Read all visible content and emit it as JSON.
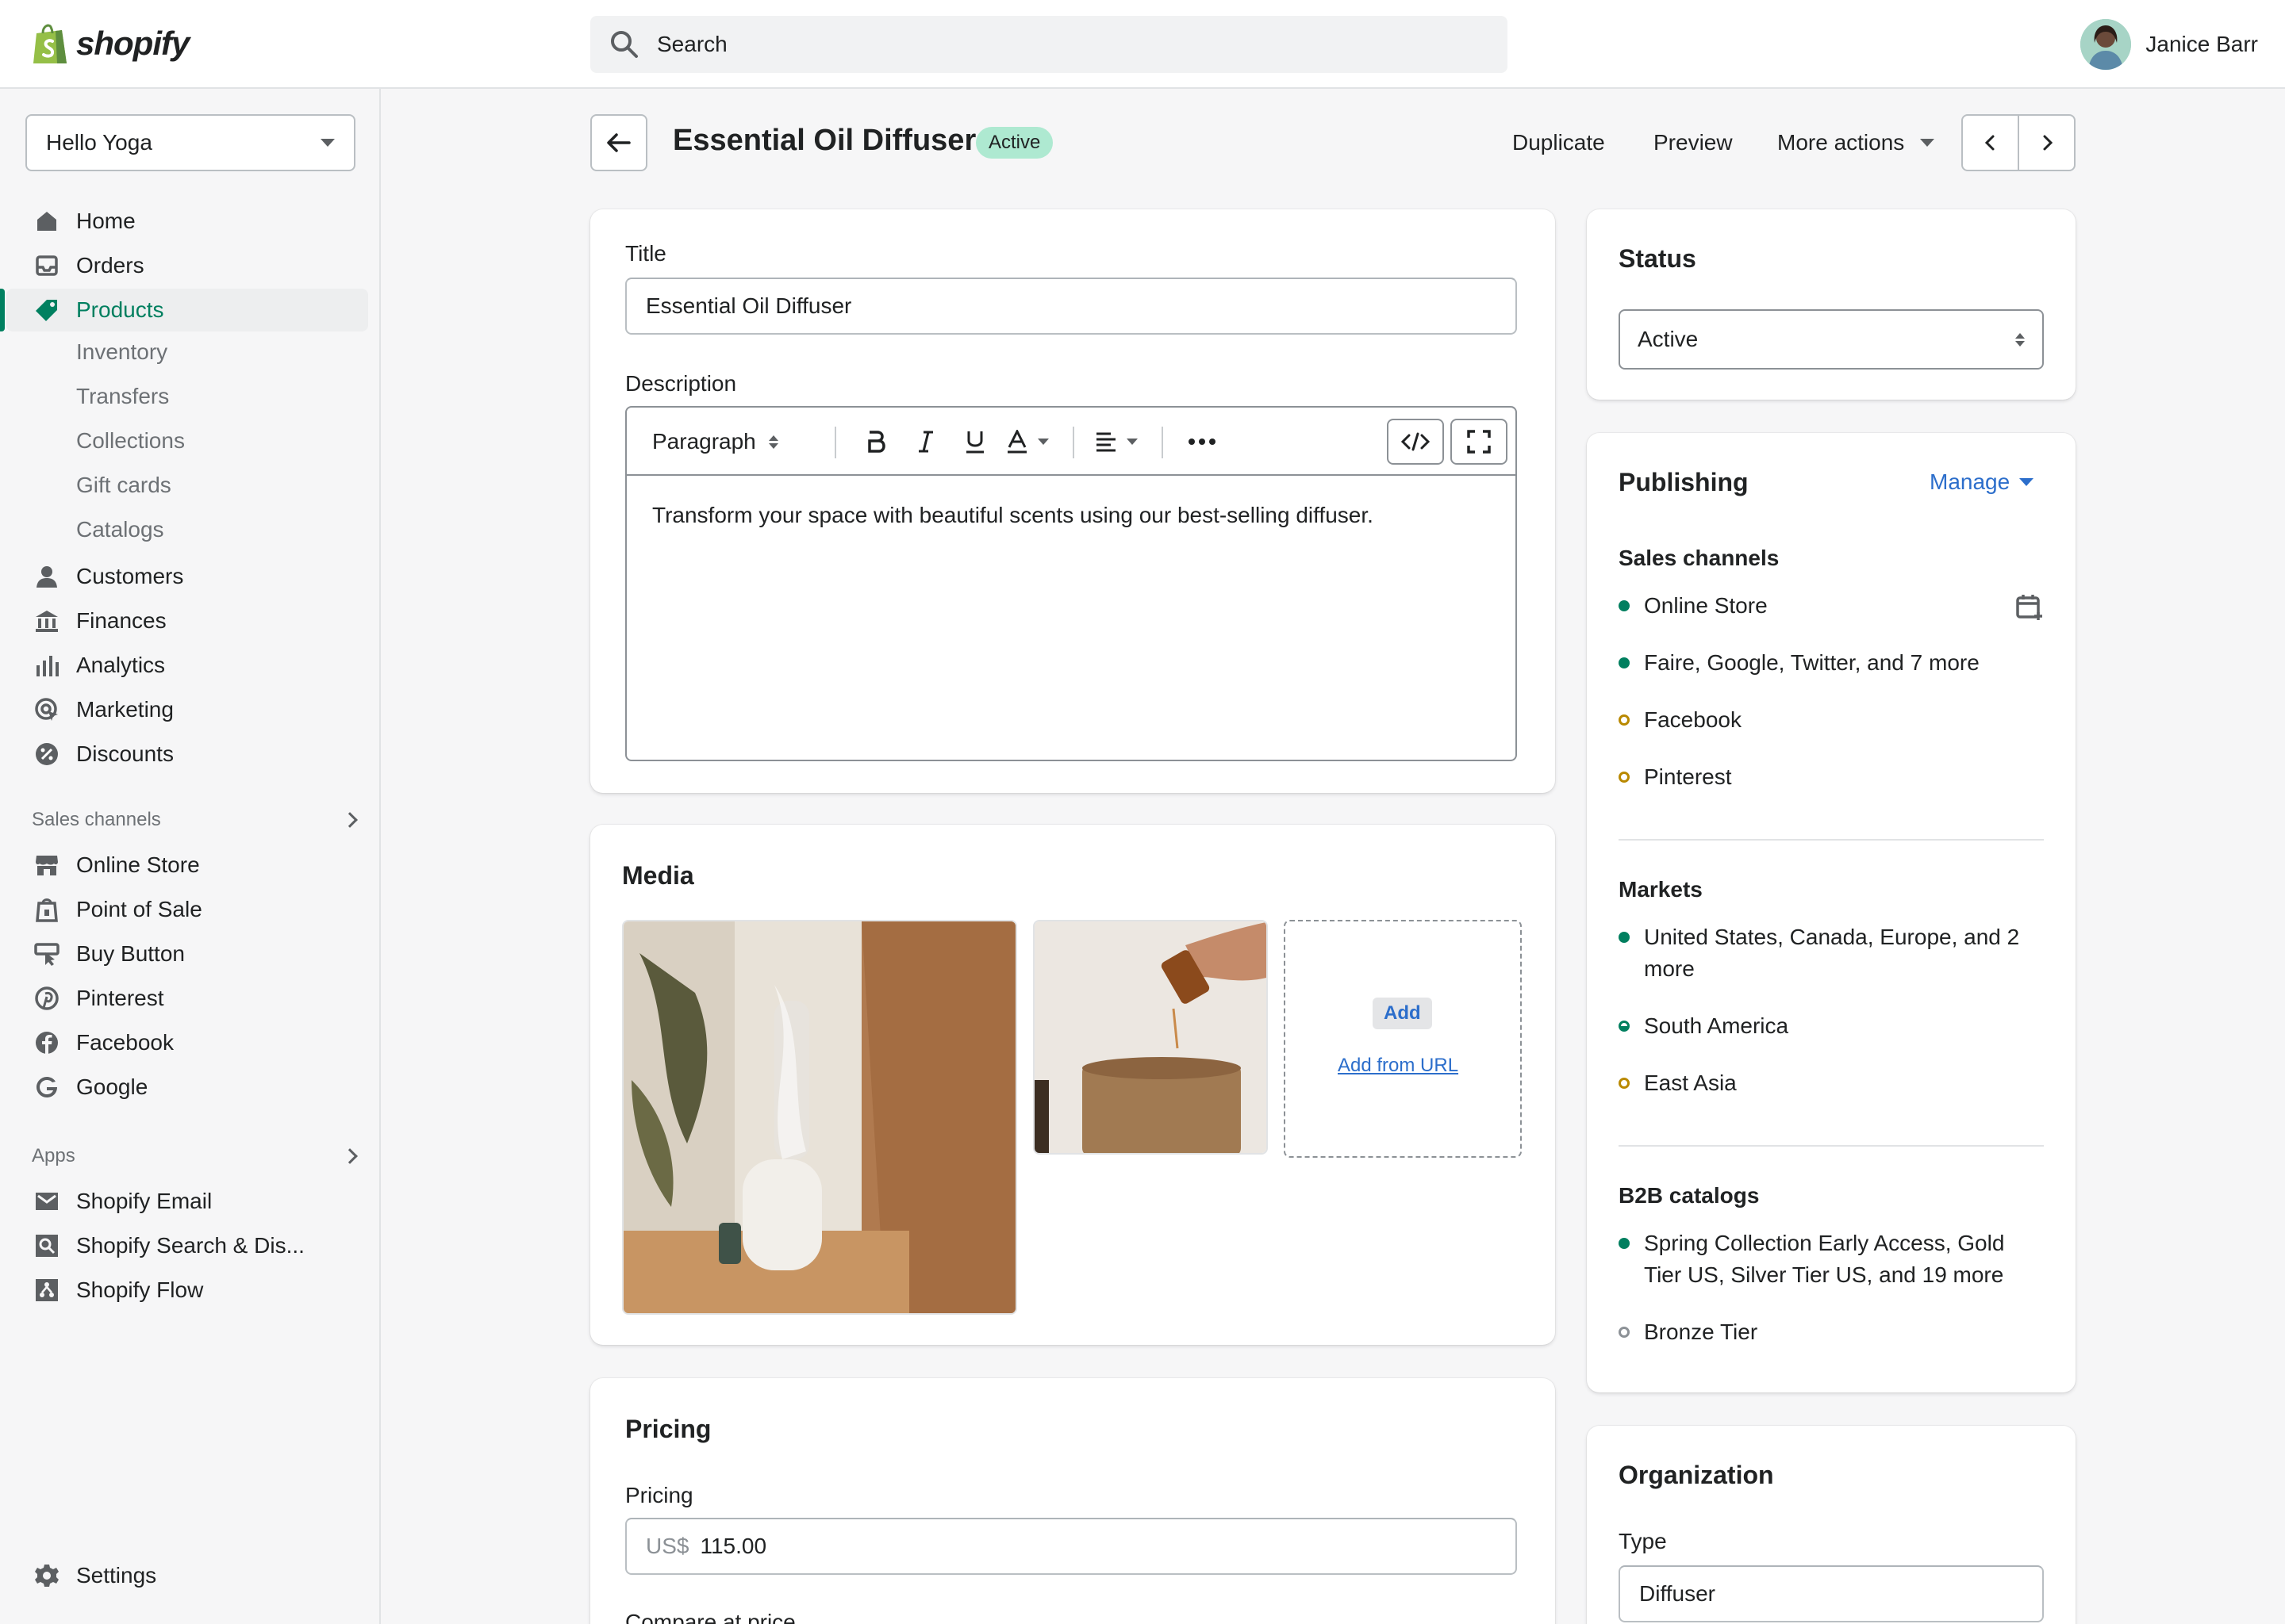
{
  "topbar": {
    "logo_text": "shopify",
    "search_placeholder": "Search",
    "user_name": "Janice Barr"
  },
  "sidebar": {
    "store_name": "Hello Yoga",
    "items": [
      {
        "label": "Home",
        "icon": "home-icon"
      },
      {
        "label": "Orders",
        "icon": "inbox-icon"
      },
      {
        "label": "Products",
        "icon": "tag-icon",
        "active": true
      },
      {
        "label": "Customers",
        "icon": "person-icon"
      },
      {
        "label": "Finances",
        "icon": "bank-icon"
      },
      {
        "label": "Analytics",
        "icon": "bar-chart-icon"
      },
      {
        "label": "Marketing",
        "icon": "target-icon"
      },
      {
        "label": "Discounts",
        "icon": "discount-icon"
      }
    ],
    "product_subitems": [
      "Inventory",
      "Transfers",
      "Collections",
      "Gift cards",
      "Catalogs"
    ],
    "sales_channels_heading": "Sales channels",
    "sales_channels": [
      {
        "label": "Online Store",
        "icon": "store-icon"
      },
      {
        "label": "Point of Sale",
        "icon": "pos-icon"
      },
      {
        "label": "Buy Button",
        "icon": "buy-button-icon"
      },
      {
        "label": "Pinterest",
        "icon": "pinterest-icon"
      },
      {
        "label": "Facebook",
        "icon": "facebook-icon"
      },
      {
        "label": "Google",
        "icon": "google-icon"
      }
    ],
    "apps_heading": "Apps",
    "apps": [
      {
        "label": "Shopify Email",
        "icon": "email-icon"
      },
      {
        "label": "Shopify Search & Dis...",
        "icon": "search-discovery-icon"
      },
      {
        "label": "Shopify Flow",
        "icon": "flow-icon"
      }
    ],
    "settings_label": "Settings"
  },
  "header": {
    "title": "Essential Oil Diffuser",
    "status_badge": "Active",
    "duplicate_label": "Duplicate",
    "preview_label": "Preview",
    "more_actions_label": "More actions"
  },
  "product": {
    "title_label": "Title",
    "title_value": "Essential Oil Diffuser",
    "description_label": "Description",
    "format_label": "Paragraph",
    "description_text": "Transform your space with beautiful scents using our best-selling diffuser."
  },
  "media": {
    "heading": "Media",
    "add_label": "Add",
    "add_url_label": "Add from URL"
  },
  "pricing": {
    "heading": "Pricing",
    "price_label": "Pricing",
    "currency": "US$",
    "price_value": "115.00",
    "compare_label": "Compare at price"
  },
  "status": {
    "heading": "Status",
    "selected": "Active"
  },
  "publishing": {
    "heading": "Publishing",
    "manage_label": "Manage",
    "sales_channels_heading": "Sales channels",
    "channels": [
      {
        "label": "Online Store",
        "state": "green"
      },
      {
        "label": "Faire, Google, Twitter, and 7 more",
        "state": "green"
      },
      {
        "label": "Facebook",
        "state": "yellow"
      },
      {
        "label": "Pinterest",
        "state": "yellow"
      }
    ],
    "markets_heading": "Markets",
    "markets": [
      {
        "label": "United States, Canada, Europe, and 2 more",
        "state": "green"
      },
      {
        "label": "South America",
        "state": "half"
      },
      {
        "label": "East Asia",
        "state": "yellow"
      }
    ],
    "b2b_heading": "B2B catalogs",
    "b2b": [
      {
        "label": "Spring Collection Early Access, Gold Tier US, Silver Tier US, and 19 more",
        "state": "green"
      },
      {
        "label": "Bronze Tier",
        "state": "grey"
      }
    ]
  },
  "organization": {
    "heading": "Organization",
    "type_label": "Type",
    "type_value": "Diffuser"
  },
  "colors": {
    "accent_green": "#008060",
    "link_blue": "#2c6ecb",
    "badge_green": "#aee9d1",
    "warning_yellow": "#b98900"
  }
}
